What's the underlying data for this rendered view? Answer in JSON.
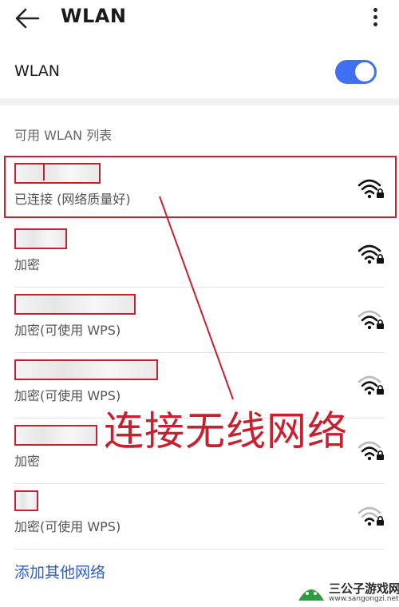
{
  "header": {
    "title": "WLAN",
    "back_icon": "back-arrow-icon",
    "more_icon": "more-vertical-icon"
  },
  "wlan_toggle": {
    "label": "WLAN",
    "state": "on",
    "accent": "#3f6ff2"
  },
  "section": {
    "title": "可用 WLAN 列表"
  },
  "networks": [
    {
      "status": "已连接 (网络质量好)",
      "signal_strength": "full",
      "secured": true
    },
    {
      "status": "加密",
      "signal_strength": "full",
      "secured": true
    },
    {
      "status": "加密(可使用 WPS)",
      "signal_strength": "medium",
      "secured": true
    },
    {
      "status": "加密(可使用 WPS)",
      "signal_strength": "medium",
      "secured": true
    },
    {
      "status": "加密",
      "signal_strength": "medium",
      "secured": true
    },
    {
      "status": "加密(可使用 WPS)",
      "signal_strength": "low",
      "secured": true
    }
  ],
  "add_network": {
    "label": "添加其他网络",
    "color": "#2f5fbf"
  },
  "annotation": {
    "text": "连接无线网络",
    "color": "#c8202e"
  },
  "watermark": {
    "name": "三公子游戏网",
    "url": "www.sangongzi.net"
  }
}
